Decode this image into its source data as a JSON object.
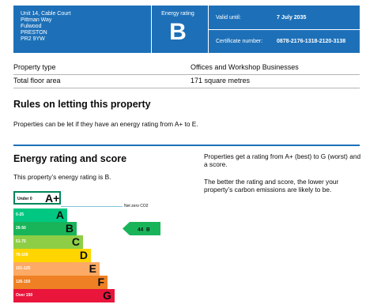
{
  "header": {
    "address_lines": [
      "Unit 14, Cable Court",
      "Pittman Way",
      "Fulwood",
      "PRESTON",
      "PR2 9YW"
    ],
    "energy_rating_label": "Energy rating",
    "energy_rating": "B",
    "valid_until_label": "Valid until:",
    "valid_until": "7 July 2035",
    "certificate_label": "Certificate number:",
    "certificate_number": "0878-2176-1318-2120-3138"
  },
  "property": {
    "rows": [
      {
        "label": "Property type",
        "value": "Offices and Workshop Businesses"
      },
      {
        "label": "Total floor area",
        "value": "171 square metres"
      }
    ]
  },
  "letting": {
    "heading": "Rules on letting this property",
    "text": "Properties can be let if they have an energy rating from A+ to E."
  },
  "rating_section": {
    "heading": "Energy rating and score",
    "current_text": "This property’s energy rating is B.",
    "explain_1": "Properties get a rating from A+ (best) to G (worst) and a score.",
    "explain_2": "The better the rating and score, the lower your property’s carbon emissions are likely to be."
  },
  "epc_chart": {
    "aplus": {
      "range": "Under 0",
      "letter": "A+"
    },
    "net_zero_label": "Net zero CO2",
    "bands": [
      {
        "range": "0-25",
        "letter": "A",
        "color": "#00c781"
      },
      {
        "range": "26-50",
        "letter": "B",
        "color": "#19b459"
      },
      {
        "range": "51-75",
        "letter": "C",
        "color": "#8dce46"
      },
      {
        "range": "76-100",
        "letter": "D",
        "color": "#ffd500"
      },
      {
        "range": "101-125",
        "letter": "E",
        "color": "#fcaa65"
      },
      {
        "range": "126-150",
        "letter": "F",
        "color": "#ef8023"
      },
      {
        "range": "Over 150",
        "letter": "G",
        "color": "#e9153b"
      }
    ],
    "score": "44",
    "score_letter": "B",
    "score_color": "#19b459"
  }
}
